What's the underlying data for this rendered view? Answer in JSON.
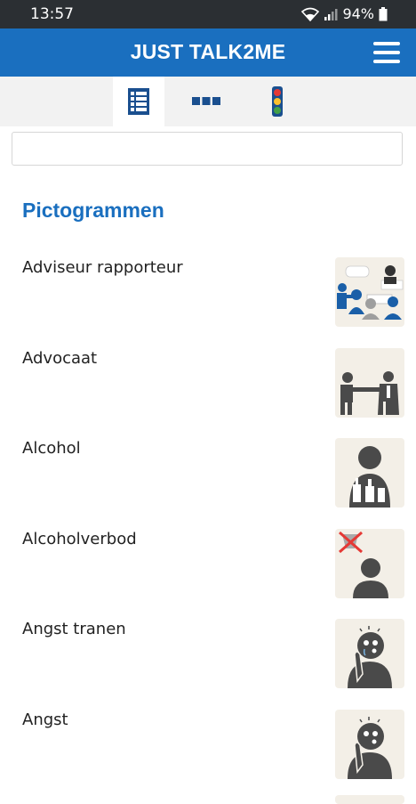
{
  "status": {
    "time": "13:57",
    "battery": "94%"
  },
  "app": {
    "title": "JUST TALK2ME"
  },
  "search": {
    "placeholder": ""
  },
  "section": {
    "title": "Pictogrammen"
  },
  "items": [
    {
      "label": "Adviseur rapporteur",
      "icon": "meeting-pictogram-icon"
    },
    {
      "label": "Advocaat",
      "icon": "handshake-lawyer-pictogram-icon"
    },
    {
      "label": "Alcohol",
      "icon": "person-bottles-pictogram-icon"
    },
    {
      "label": "Alcoholverbod",
      "icon": "no-alcohol-pictogram-icon"
    },
    {
      "label": "Angst tranen",
      "icon": "fear-tears-pictogram-icon"
    },
    {
      "label": "Angst",
      "icon": "fear-pictogram-icon"
    }
  ],
  "colors": {
    "primary": "#1a6fbf",
    "statusbar": "#2b2f33",
    "pictoBg": "#f3efe7",
    "pictoGray": "#4a4a4a"
  }
}
